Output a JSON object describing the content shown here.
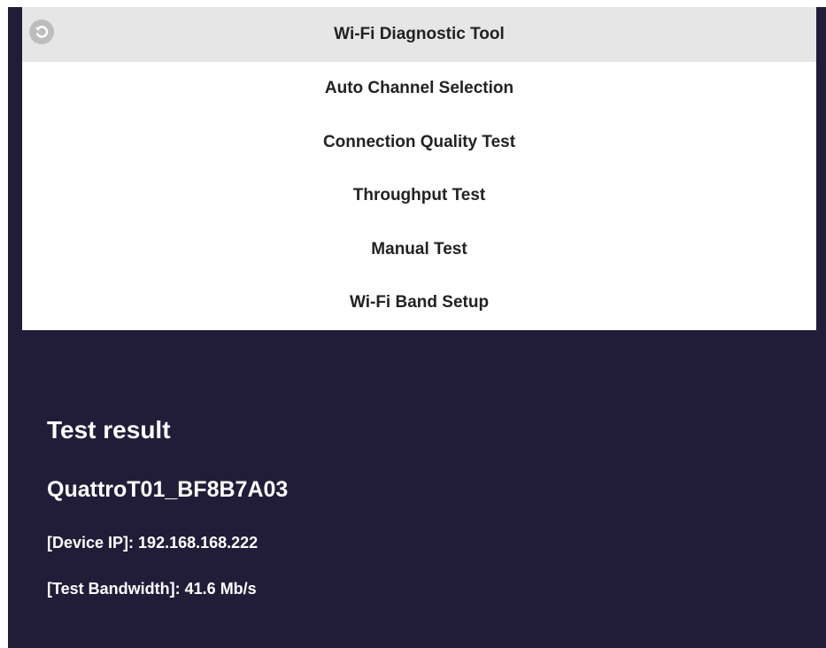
{
  "menu": {
    "title": "Wi-Fi Diagnostic Tool",
    "back_icon": "back-icon",
    "items": [
      {
        "label": "Auto Channel Selection"
      },
      {
        "label": "Connection Quality Test"
      },
      {
        "label": "Throughput Test"
      },
      {
        "label": "Manual Test"
      },
      {
        "label": "Wi-Fi Band Setup"
      }
    ]
  },
  "result": {
    "heading": "Test result",
    "device_name": "QuattroT01_BF8B7A03",
    "device_ip_label": "[Device IP]",
    "device_ip": "192.168.168.222",
    "bandwidth_label": "[Test Bandwidth]",
    "bandwidth": "41.6 Mb/s"
  },
  "colors": {
    "background": "#211d38",
    "menu_header": "#e6e6e6",
    "menu_panel": "#ffffff",
    "back_button": "#bdbdbd"
  }
}
